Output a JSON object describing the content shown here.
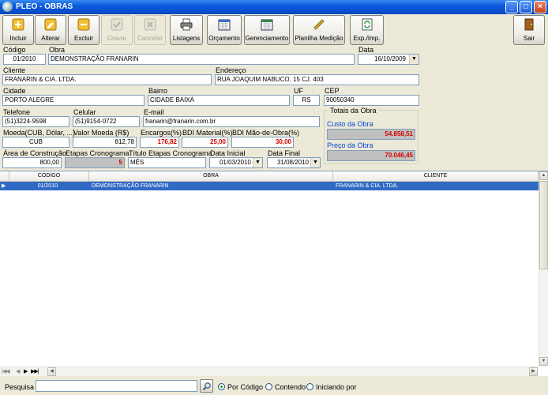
{
  "window": {
    "title": "PLEO - OBRAS"
  },
  "toolbar": {
    "incluir": "Incluir",
    "alterar": "Alterar",
    "excluir": "Excluir",
    "gravar": "Gravar",
    "cancelar": "Cancelar",
    "listagens": "Listagens",
    "orcamento": "Orçamento",
    "gerenciamento": "Gerenciamento",
    "planilha": "Planilha Medição",
    "exp": "Exp./Imp.",
    "sair": "Sair"
  },
  "form": {
    "codigo_label": "Código",
    "codigo": "01/2010",
    "obra_label": "Obra",
    "obra": "DEMONSTRAÇÃO FRANARIN",
    "data_label": "Data",
    "data": "16/10/2009",
    "cliente_label": "Cliente",
    "cliente": "FRANARIN & CIA. LTDA.",
    "endereco_label": "Endereço",
    "endereco": "RUA JOAQUIM NABUCO, 15 CJ. 403",
    "cidade_label": "Cidade",
    "cidade": "PORTO ALEGRE",
    "bairro_label": "Bairro",
    "bairro": "CIDADE BAIXA",
    "uf_label": "UF",
    "uf": "RS",
    "cep_label": "CEP",
    "cep": "90050340",
    "telefone_label": "Telefone",
    "telefone": "(51)3224-9598",
    "celular_label": "Celular",
    "celular": "(51)9154-0722",
    "email_label": "E-mail",
    "email": "franarin@franarin.com.br",
    "moeda_label": "Moeda(CUB, Dólar, ...)",
    "moeda": "CUB",
    "valor_moeda_label": "Valor Moeda (R$)",
    "valor_moeda": "812,78",
    "encargos_label": "Encargos(%)",
    "encargos": "176,82",
    "bdi_material_label": "BDI Material(%)",
    "bdi_material": "25,00",
    "bdi_mao_label": "BDI Mão-de-Obra(%)",
    "bdi_mao": "30,00",
    "area_label": "Área de Construção",
    "area": "800,00",
    "etapas_label": "Etapas Cronograma",
    "etapas": "5",
    "titulo_etapas_label": "Título Etapas Cronograma",
    "titulo_etapas": "MÊS",
    "data_inicial_label": "Data Inicial",
    "data_inicial": "01/03/2010",
    "data_final_label": "Data Final",
    "data_final": "31/08/2010"
  },
  "totals": {
    "title": "Totais da Obra",
    "custo_label": "Custo da Obra",
    "custo": "54.858,51",
    "preco_label": "Preço da Obra",
    "preco": "70.046,45"
  },
  "grid": {
    "columns": [
      "CÓDIGO",
      "OBRA",
      "CLIENTE"
    ],
    "rows": [
      {
        "codigo": "01/2010",
        "obra": "DEMONSTRAÇÃO FRANARIN",
        "cliente": "FRANARIN & CIA. LTDA."
      }
    ]
  },
  "search": {
    "label": "Pesquisa",
    "value": "",
    "options": [
      "Por Código",
      "Contendo",
      "Iniciando por"
    ],
    "selected": "Por Código"
  }
}
